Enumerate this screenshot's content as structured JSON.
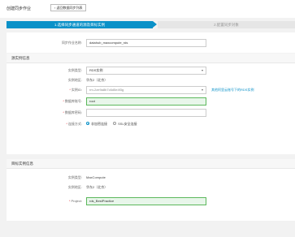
{
  "header": {
    "title": "创建同步作业",
    "back_label": "返回数据同步列表"
  },
  "steps": [
    {
      "label": "1.选择同步通道的源及目标实例",
      "active": true
    },
    {
      "label": "2.配置同步对象",
      "active": false
    }
  ],
  "job": {
    "name_label": "同步作业名称:",
    "name_value": "datahub_maxcompute_rds"
  },
  "source": {
    "section_title": "源实例信息",
    "instance_type_label": "实例类型:",
    "instance_type_value": "RDS实例",
    "region_label": "实例地区:",
    "region_value": "华东2（北京）",
    "instance_id_label": "实例ID:",
    "instance_id_value": "rm-2ze9a8b7c6d5e4f3g",
    "other_link": "其他阿里云账号下的RDS实例",
    "db_account_label": "数据库账号:",
    "db_account_value": "root",
    "db_password_label": "数据库密码:",
    "db_password_value": "",
    "conn_label": "连接方式:",
    "conn_options": [
      "非加密连接",
      "SSL安全连接"
    ],
    "conn_selected": 0
  },
  "target": {
    "section_title": "目标实例信息",
    "instance_type_label": "实例类型:",
    "instance_type_value": "MaxCompute",
    "region_label": "实例地区:",
    "region_value": "华东2（北京）",
    "project_label": "Project:",
    "project_value": "rds_BestPractice"
  }
}
